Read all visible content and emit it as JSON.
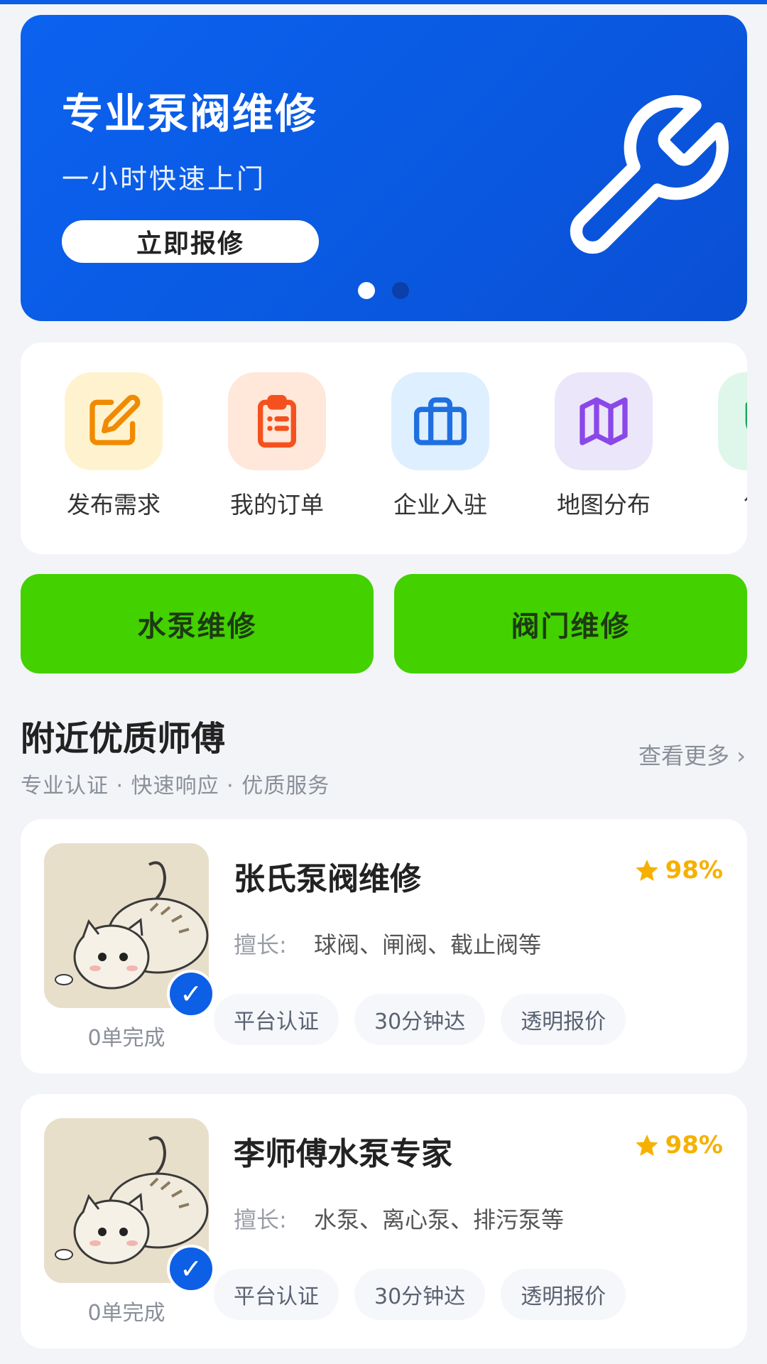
{
  "banner": {
    "title": "专业泵阀维修",
    "subtitle": "一小时快速上门",
    "button": "立即报修",
    "icon": "wrench-icon",
    "slide_count": 2,
    "active_slide": 1
  },
  "menu": {
    "items": [
      {
        "label": "发布需求",
        "icon": "edit-icon",
        "bg": "#fff3cf",
        "color": "#f08a00"
      },
      {
        "label": "我的订单",
        "icon": "clipboard-icon",
        "bg": "#ffe7d9",
        "color": "#f4511e"
      },
      {
        "label": "企业入驻",
        "icon": "briefcase-icon",
        "bg": "#deefff",
        "color": "#1f6fe0"
      },
      {
        "label": "地图分布",
        "icon": "map-icon",
        "bg": "#ece6fa",
        "color": "#8a48e8"
      },
      {
        "label": "售后",
        "icon": "shield-icon",
        "bg": "#dff7ea",
        "color": "#1aa35c"
      }
    ]
  },
  "service_buttons": [
    "水泵维修",
    "阀门维修"
  ],
  "section": {
    "title": "附近优质师傅",
    "subtitle": "专业认证 · 快速响应 · 优质服务",
    "more": "查看更多 ›"
  },
  "masters": [
    {
      "name": "张氏泵阀维修",
      "rating": "98%",
      "skill_label": "擅长:",
      "skills": "球阀、闸阀、截止阀等",
      "completed": "0单完成",
      "tags": [
        "平台认证",
        "30分钟达",
        "透明报价"
      ]
    },
    {
      "name": "李师傅水泵专家",
      "rating": "98%",
      "skill_label": "擅长:",
      "skills": "水泵、离心泵、排污泵等",
      "completed": "0单完成",
      "tags": [
        "平台认证",
        "30分钟达",
        "透明报价"
      ]
    }
  ],
  "colors": {
    "brand_blue": "#0b62ef",
    "green": "#43d100",
    "rating": "#f6b100"
  }
}
